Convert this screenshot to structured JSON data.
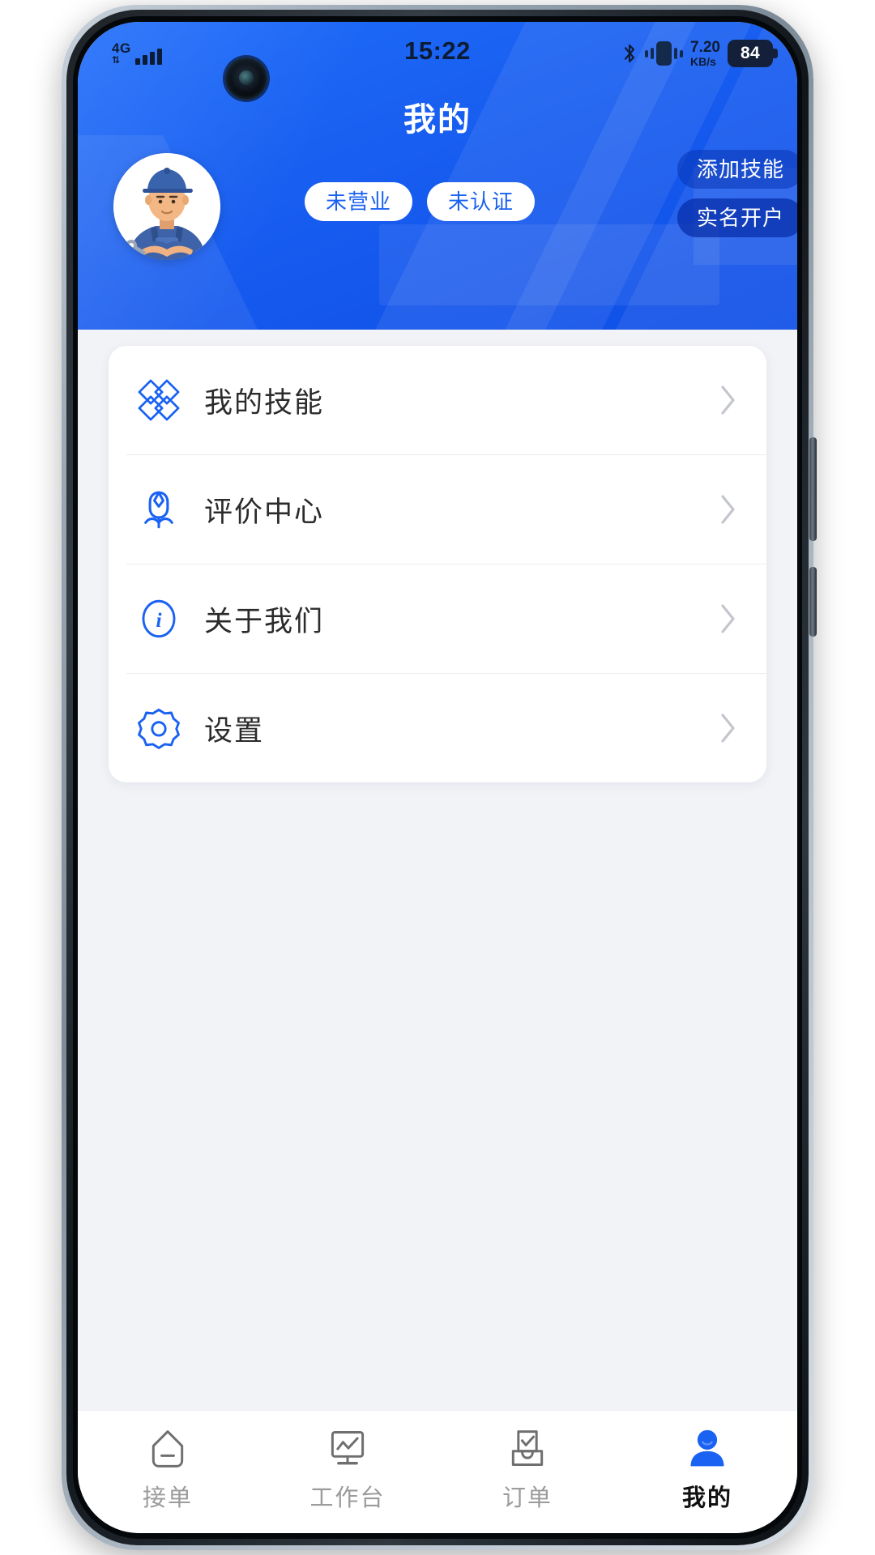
{
  "statusbar": {
    "network_type": "4G",
    "time": "15:22",
    "net_speed_value": "7.20",
    "net_speed_unit": "KB/s",
    "battery_level": "84",
    "icons": [
      "signal-icon",
      "bluetooth-icon",
      "vibrate-icon",
      "battery-icon"
    ]
  },
  "header": {
    "title": "我的",
    "accent_color": "#1a62f2",
    "avatar_alt": "worker-avatar",
    "badges": [
      {
        "label": "未营业",
        "name": "status-badge-business"
      },
      {
        "label": "未认证",
        "name": "status-badge-certification"
      }
    ],
    "actions": [
      {
        "label": "添加技能",
        "name": "add-skill-button"
      },
      {
        "label": "实名开户",
        "name": "real-name-account-button"
      }
    ]
  },
  "menu": {
    "items": [
      {
        "label": "我的技能",
        "icon": "skills-diamond-icon",
        "name": "menu-item-my-skills"
      },
      {
        "label": "评价中心",
        "icon": "tulip-review-icon",
        "name": "menu-item-review-center"
      },
      {
        "label": "关于我们",
        "icon": "info-circle-icon",
        "name": "menu-item-about-us"
      },
      {
        "label": "设置",
        "icon": "gear-icon",
        "name": "menu-item-settings"
      }
    ]
  },
  "tabbar": {
    "active_index": 3,
    "active_color": "#1a62f2",
    "inactive_color": "#9b9b9b",
    "items": [
      {
        "label": "接单",
        "icon": "tag-home-icon",
        "name": "tab-take-orders"
      },
      {
        "label": "工作台",
        "icon": "monitor-chart-icon",
        "name": "tab-workbench"
      },
      {
        "label": "订单",
        "icon": "inbox-check-icon",
        "name": "tab-orders"
      },
      {
        "label": "我的",
        "icon": "person-icon",
        "name": "tab-mine"
      }
    ]
  }
}
